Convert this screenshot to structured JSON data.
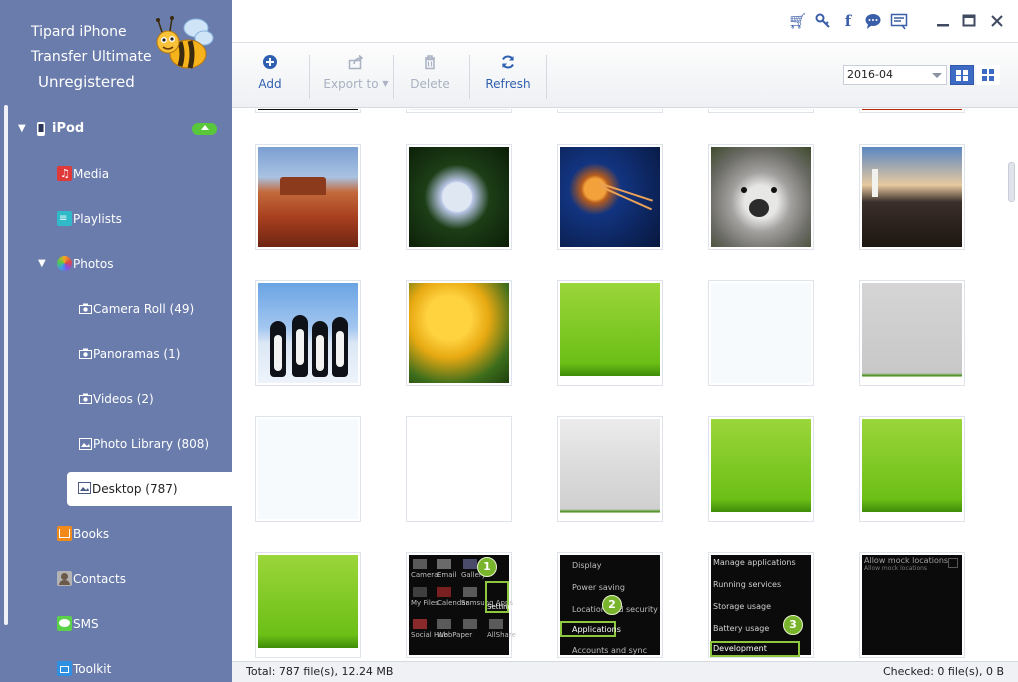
{
  "app": {
    "title_line1": "Tipard iPhone",
    "title_line2": "Transfer Ultimate",
    "registration": "Unregistered"
  },
  "window_controls": [
    "cart-icon",
    "key-icon",
    "facebook-icon",
    "chat-icon",
    "feedback-icon",
    "minimize-icon",
    "maximize-icon",
    "close-icon"
  ],
  "sidebar": {
    "device": "iPod",
    "items": [
      {
        "label": "Media",
        "icon": "music-icon",
        "color": "#e0393a"
      },
      {
        "label": "Playlists",
        "icon": "playlist-icon",
        "color": "#2fb9c9"
      },
      {
        "label": "Photos",
        "icon": "photos-icon",
        "color": "#f4a623"
      },
      {
        "label": "Camera Roll (49)",
        "icon": "camera-icon"
      },
      {
        "label": "Panoramas (1)",
        "icon": "camera-icon"
      },
      {
        "label": "Videos (2)",
        "icon": "camera-icon"
      },
      {
        "label": "Photo Library (808)",
        "icon": "picture-icon"
      },
      {
        "label": "Desktop (787)",
        "icon": "picture-icon"
      },
      {
        "label": "Books",
        "icon": "book-icon",
        "color": "#f28a1a"
      },
      {
        "label": "Contacts",
        "icon": "contacts-icon",
        "color": "#9b9b9b"
      },
      {
        "label": "SMS",
        "icon": "sms-icon",
        "color": "#5bd14a"
      },
      {
        "label": "Toolkit",
        "icon": "toolkit-icon",
        "color": "#2f8fe0"
      }
    ],
    "selected": "Desktop (787)"
  },
  "toolbar": {
    "add": "Add",
    "export": "Export to",
    "delete": "Delete",
    "refresh": "Refresh",
    "date_filter": "2016-04"
  },
  "accent_color": "#3d6bc4",
  "thumbnails_partial_top": [
    "im-black",
    "im-paleblue",
    "im-white",
    "im-white",
    "im-red"
  ],
  "thumbnails": [
    [
      "desert",
      "hydrangea",
      "jellyfish",
      "koala",
      "lighthouse"
    ],
    [
      "penguins",
      "tulips",
      "green",
      "white",
      "gray"
    ],
    [
      "white",
      "white",
      "gray",
      "green",
      "green"
    ],
    [
      "green",
      "android-settings",
      "android-applications",
      "android-development",
      "android-mock-locations"
    ]
  ],
  "screens": {
    "settings": {
      "labels": [
        "Camera",
        "Email",
        "Gallery",
        "My Files",
        "Calendar",
        "Samsung Apps",
        "Settings",
        "Social Hub",
        "WebPaper",
        "AllShare"
      ],
      "pin": "1"
    },
    "applications": {
      "labels": [
        "Display",
        "Power saving",
        "Location and security",
        "Applications",
        "Accounts and sync"
      ],
      "pin": "2"
    },
    "development": {
      "labels": [
        "Manage applications",
        "Running services",
        "Storage usage",
        "Battery usage",
        "Development"
      ],
      "pin": "3"
    },
    "mock": {
      "labels": [
        "Allow mock locations",
        "Allow mock locations"
      ]
    }
  },
  "status": {
    "total": "Total: 787 file(s), 12.24 MB",
    "checked": "Checked: 0 file(s), 0 B"
  }
}
